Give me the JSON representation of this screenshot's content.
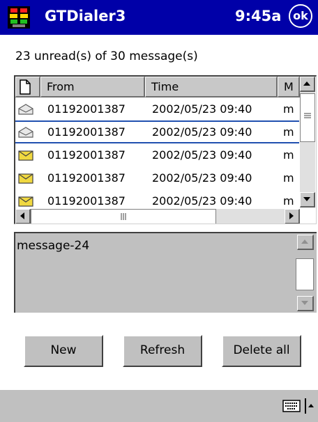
{
  "titlebar": {
    "app_title": "GTDialer3",
    "clock": "9:45a",
    "ok_label": "ok"
  },
  "summary": "23 unread(s) of 30 message(s)",
  "list": {
    "columns": [
      "",
      "From",
      "Time",
      "M"
    ],
    "rows": [
      {
        "icon": "envelope-read-icon",
        "from": "01192001387",
        "time": "2002/05/23 09:40",
        "message": "m",
        "read": true
      },
      {
        "icon": "envelope-read-icon",
        "from": "01192001387",
        "time": "2002/05/23 09:40",
        "message": "m",
        "read": true,
        "selected": true
      },
      {
        "icon": "envelope-unread-icon",
        "from": "01192001387",
        "time": "2002/05/23 09:40",
        "message": "m",
        "read": false
      },
      {
        "icon": "envelope-unread-icon",
        "from": "01192001387",
        "time": "2002/05/23 09:40",
        "message": "m",
        "read": false
      },
      {
        "icon": "envelope-unread-icon",
        "from": "01192001387",
        "time": "2002/05/23 09:40",
        "message": "m",
        "read": false
      }
    ]
  },
  "preview": {
    "text": "message-24"
  },
  "buttons": {
    "new": "New",
    "refresh": "Refresh",
    "delete_all": "Delete all"
  },
  "colors": {
    "titlebar": "#0000a8",
    "chrome": "#c0c0c0",
    "selection": "#2050b0"
  }
}
